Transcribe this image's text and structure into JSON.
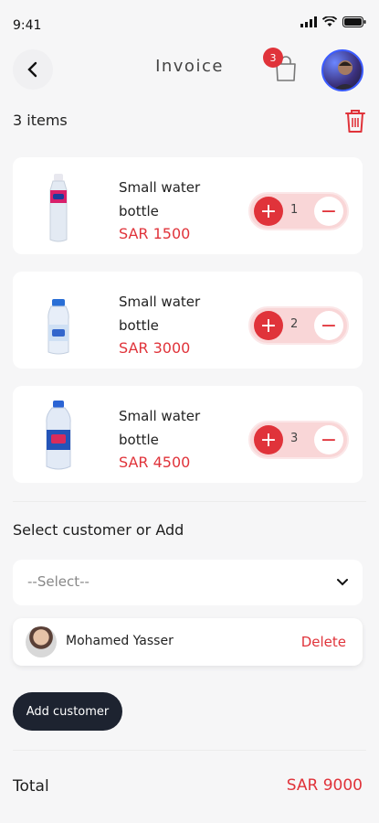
{
  "status_bar": {
    "time": "9:41",
    "icons": [
      "signal-icon",
      "wifi-icon",
      "battery-icon"
    ]
  },
  "header": {
    "title": "Invoice",
    "cart_badge": "3"
  },
  "cart": {
    "items_count": "3 items",
    "items": [
      {
        "name": "Small water bottle",
        "price": "SAR 1500",
        "quantity": "1"
      },
      {
        "name": "Small water bottle",
        "price": "SAR 3000",
        "quantity": "2"
      },
      {
        "name": "Small water bottle",
        "price": "SAR 4500",
        "quantity": "3"
      }
    ],
    "plus_glyph": "+",
    "minus_glyph": "−"
  },
  "customer": {
    "section_label": "Select customer or Add",
    "select_placeholder": "--Select--",
    "selected_name": "Mohamed Yasser",
    "delete_label": "Delete",
    "add_label": "Add customer"
  },
  "totals": {
    "label": "Total",
    "value": "SAR 9000"
  },
  "colors": {
    "accent": "#e0333a",
    "stepper_bg": "#f9d6d7",
    "dark_button": "#1d2330"
  }
}
